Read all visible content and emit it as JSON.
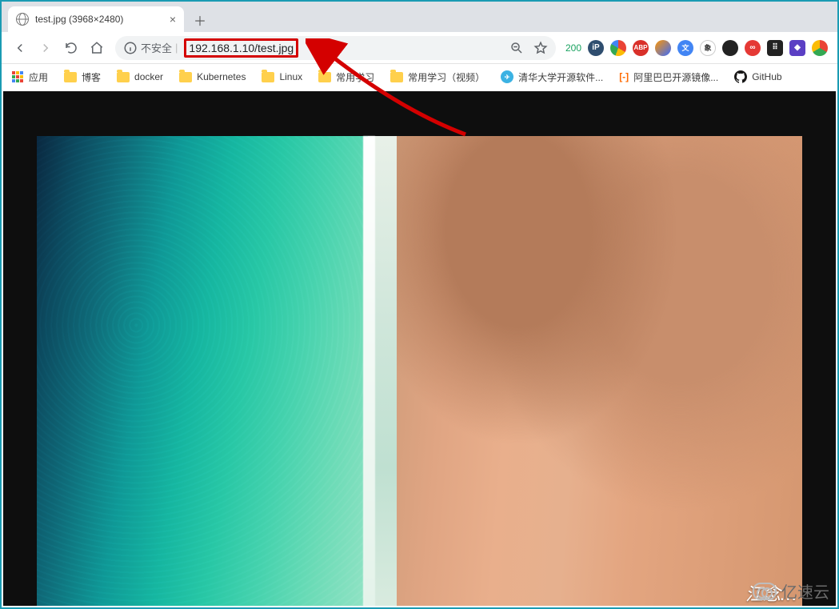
{
  "tab": {
    "title": "test.jpg (3968×2480)",
    "favicon": "globe-icon"
  },
  "nav": {
    "back": "←",
    "forward": "→",
    "reload": "⟳",
    "home": "⌂"
  },
  "address": {
    "security_icon": "info-icon",
    "security_label": "不安全",
    "url": "192.168.1.10/test.jpg",
    "zoom_icon": "🔍",
    "star_icon": "☆",
    "status_code": "200"
  },
  "extensions": [
    {
      "name": "ip-icon",
      "bg": "#2f4e6f",
      "text": "iP"
    },
    {
      "name": "opera-icon",
      "bg": "#ffffff",
      "text": "O",
      "fg": "#e33",
      "ring": "linear-gradient(135deg,#f7b500,#e33,#06f)"
    },
    {
      "name": "adblock-icon",
      "bg": "#d9302a",
      "text": "ABP"
    },
    {
      "name": "firefox-icon",
      "bg": "linear-gradient(135deg,#ff9500,#3a6cff)",
      "text": ""
    },
    {
      "name": "translate-icon",
      "bg": "#4285f4",
      "text": "文"
    },
    {
      "name": "evernote-icon",
      "bg": "#fff",
      "text": "象",
      "fg": "#333"
    },
    {
      "name": "wheel-icon",
      "bg": "#222",
      "text": ""
    },
    {
      "name": "infinity-icon",
      "bg": "#e53935",
      "text": "∞"
    },
    {
      "name": "dice-icon",
      "bg": "#222",
      "text": "⠿"
    },
    {
      "name": "diamond-icon",
      "bg": "#5b3fc4",
      "text": "◆"
    },
    {
      "name": "chrome-icon",
      "bg": "linear-gradient(135deg,#ea4335 33%,#34a853 33% 66%,#fbbc05 66%)",
      "text": ""
    }
  ],
  "bookmarks": {
    "apps_label": "应用",
    "items": [
      {
        "label": "博客",
        "icon": "folder"
      },
      {
        "label": "docker",
        "icon": "folder"
      },
      {
        "label": "Kubernetes",
        "icon": "folder"
      },
      {
        "label": "Linux",
        "icon": "folder"
      },
      {
        "label": "常用学习",
        "icon": "folder"
      },
      {
        "label": "常用学习（视频）",
        "icon": "folder"
      },
      {
        "label": "清华大学开源软件...",
        "icon": "tsinghua-icon"
      },
      {
        "label": "阿里巴巴开源镜像...",
        "icon": "aliyun-icon"
      },
      {
        "label": "GitHub",
        "icon": "github-icon"
      }
    ]
  },
  "image": {
    "alt": "aerial beach photo (sea and sand)",
    "watermark": "江念…"
  },
  "page_watermark": "亿速云"
}
